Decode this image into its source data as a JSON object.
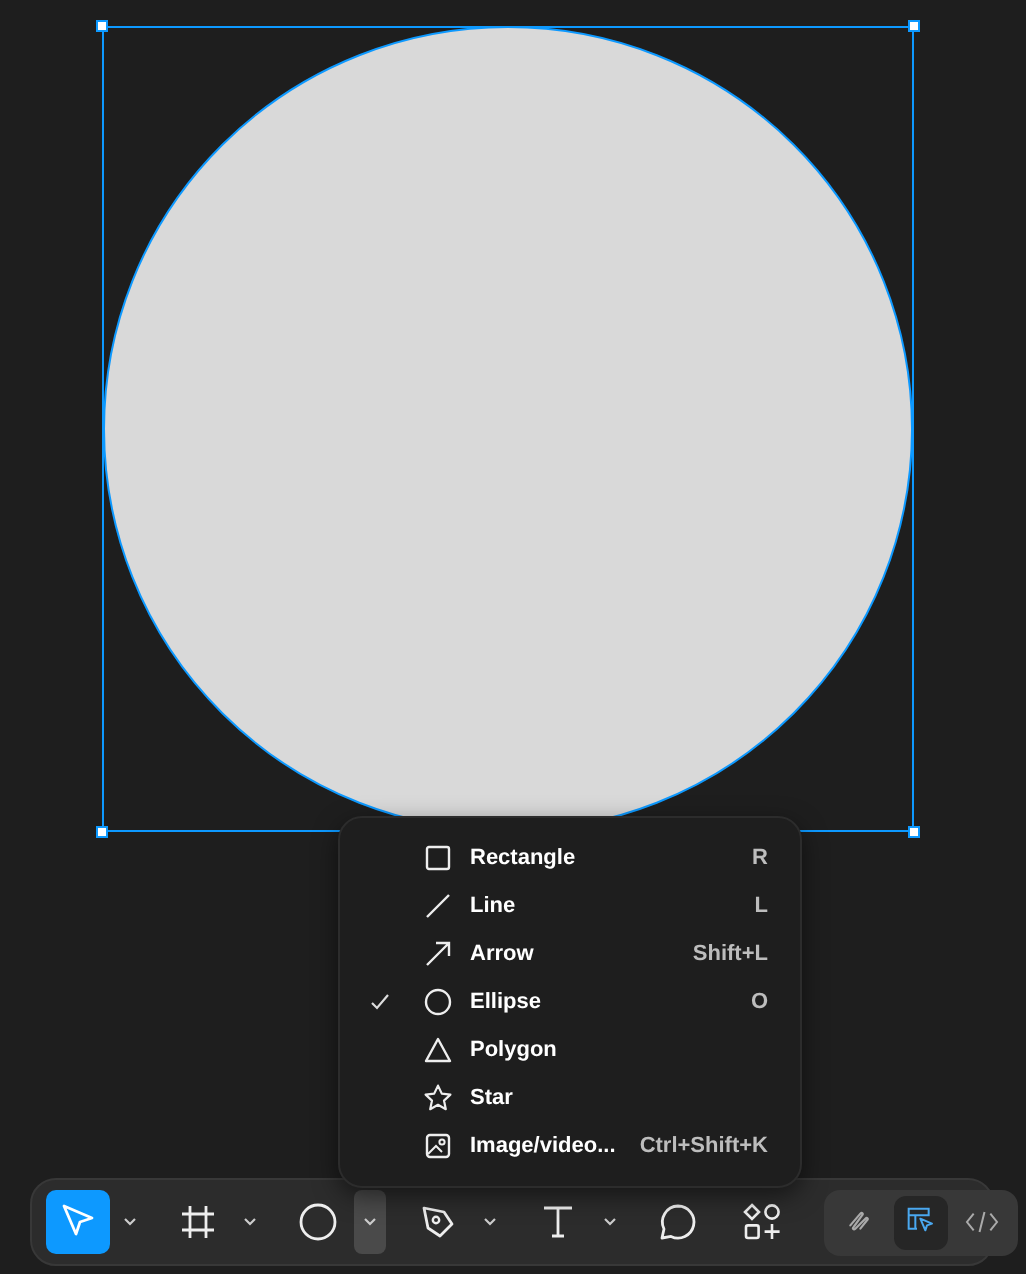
{
  "shape_menu": {
    "items": [
      {
        "kind": "rectangle",
        "label": "Rectangle",
        "shortcut": "R",
        "checked": false
      },
      {
        "kind": "line",
        "label": "Line",
        "shortcut": "L",
        "checked": false
      },
      {
        "kind": "arrow",
        "label": "Arrow",
        "shortcut": "Shift+L",
        "checked": false
      },
      {
        "kind": "ellipse",
        "label": "Ellipse",
        "shortcut": "O",
        "checked": true
      },
      {
        "kind": "polygon",
        "label": "Polygon",
        "checked": false
      },
      {
        "kind": "star",
        "label": "Star",
        "checked": false
      },
      {
        "kind": "image",
        "label": "Image/video...",
        "shortcut": "Ctrl+Shift+K",
        "checked": false
      }
    ]
  },
  "toolbar": {
    "tools": [
      {
        "kind": "move",
        "selected": true,
        "has_menu": true,
        "menu_open": false
      },
      {
        "kind": "frame",
        "selected": false,
        "has_menu": true,
        "menu_open": false
      },
      {
        "kind": "ellipse",
        "selected": false,
        "has_menu": true,
        "menu_open": true
      },
      {
        "kind": "pen",
        "selected": false,
        "has_menu": true,
        "menu_open": false
      },
      {
        "kind": "text",
        "selected": false,
        "has_menu": true,
        "menu_open": false
      },
      {
        "kind": "comment",
        "selected": false,
        "has_menu": false
      },
      {
        "kind": "actions",
        "selected": false,
        "has_menu": false
      }
    ],
    "modes": [
      {
        "kind": "draw",
        "selected": false
      },
      {
        "kind": "design",
        "selected": true
      },
      {
        "kind": "dev",
        "selected": false
      }
    ]
  }
}
